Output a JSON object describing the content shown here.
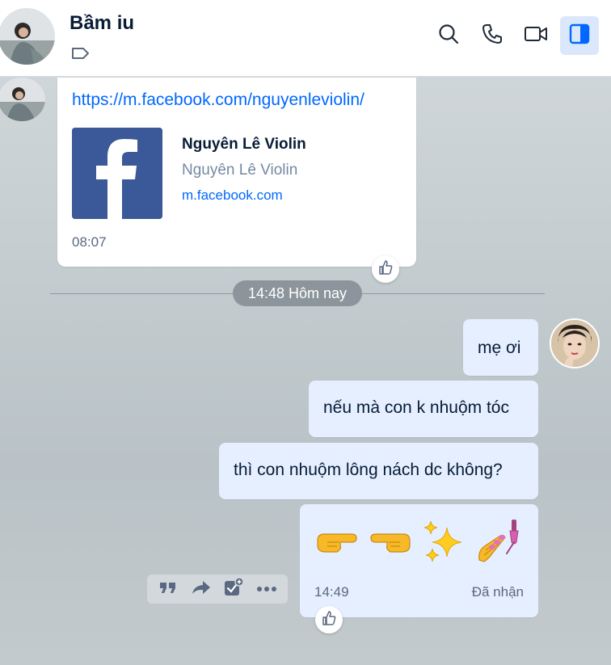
{
  "header": {
    "contact_name": "Bầm iu",
    "icons": [
      "tag-icon",
      "search-icon",
      "phone-icon",
      "video-call-icon",
      "side-panel-icon"
    ]
  },
  "messages": {
    "link_card": {
      "url": "https://m.facebook.com/nguyenleviolin/",
      "preview_title": "Nguyên Lê Violin",
      "preview_description": "Nguyên Lê Violin",
      "preview_domain": "m.facebook.com",
      "time": "08:07"
    },
    "date_separator": "14:48 Hôm nay",
    "outgoing": [
      {
        "text": "mẹ ơi"
      },
      {
        "text": "nếu mà con k nhuộm tóc"
      },
      {
        "text": "thì con nhuộm lông nách dc không?"
      }
    ],
    "emoji_message": {
      "emojis": [
        "pointing-right-emoji",
        "pointing-left-emoji",
        "sparkles-emoji",
        "nail-polish-emoji"
      ],
      "time": "14:49",
      "status": "Đã nhận"
    }
  },
  "action_bar": {
    "icons": [
      "quote-icon",
      "forward-icon",
      "add-task-icon",
      "more-icon"
    ]
  },
  "colors": {
    "accent": "#0068ff",
    "bubble_outgoing": "#e5efff",
    "facebook": "#3b5998"
  }
}
